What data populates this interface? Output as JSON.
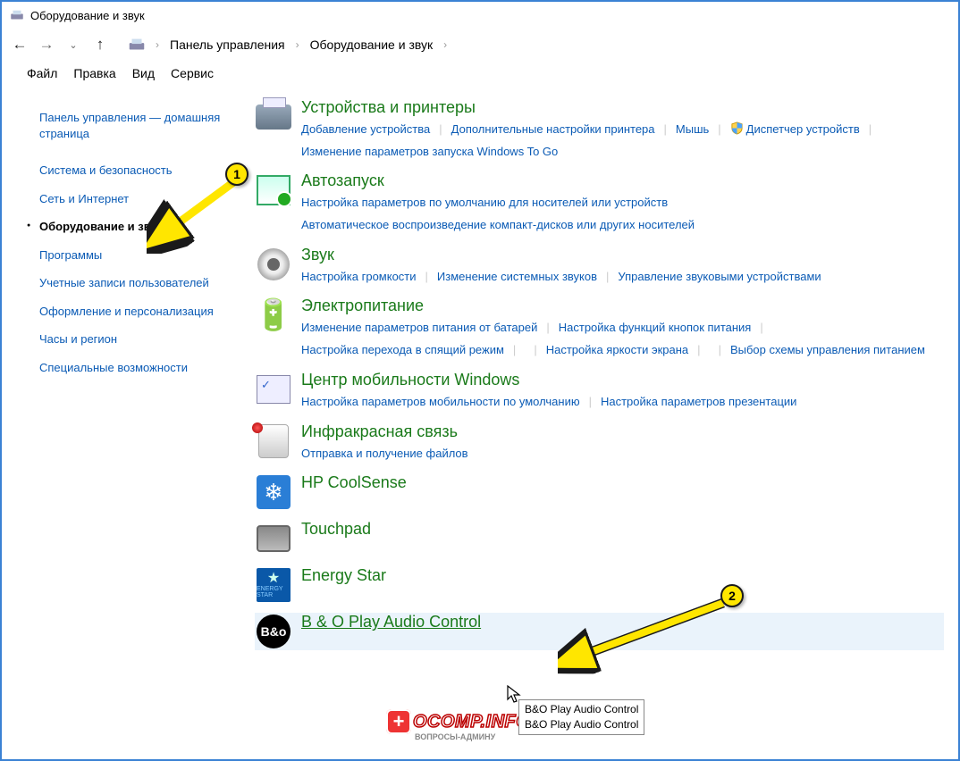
{
  "window": {
    "title": "Оборудование и звук"
  },
  "breadcrumb": {
    "root": "Панель управления",
    "current": "Оборудование и звук"
  },
  "menus": {
    "file": "Файл",
    "edit": "Правка",
    "view": "Вид",
    "service": "Сервис"
  },
  "sidebar": {
    "home": "Панель управления — домашняя страница",
    "items": [
      "Система и безопасность",
      "Сеть и Интернет",
      "Оборудование и звук",
      "Программы",
      "Учетные записи пользователей",
      "Оформление и персонализация",
      "Часы и регион",
      "Специальные возможности"
    ],
    "activeIndex": 2
  },
  "categories": [
    {
      "id": "devices",
      "title": "Устройства и принтеры",
      "sub": [
        "Добавление устройства",
        "Дополнительные настройки принтера",
        "Мышь",
        "Диспетчер устройств",
        "Изменение параметров запуска Windows To Go"
      ],
      "shieldIndex": 3
    },
    {
      "id": "autoplay",
      "title": "Автозапуск",
      "sub": [
        "Настройка параметров по умолчанию для носителей или устройств",
        "Автоматическое воспроизведение компакт-дисков или других носителей"
      ]
    },
    {
      "id": "sound",
      "title": "Звук",
      "sub": [
        "Настройка громкости",
        "Изменение системных звуков",
        "Управление звуковыми устройствами"
      ]
    },
    {
      "id": "power",
      "title": "Электропитание",
      "sub": [
        "Изменение параметров питания от батарей",
        "Настройка функций кнопок питания",
        "Настройка перехода в спящий режим",
        "Настройка яркости экрана",
        "Выбор схемы управления питанием"
      ]
    },
    {
      "id": "mobility",
      "title": "Центр мобильности Windows",
      "sub": [
        "Настройка параметров мобильности по умолчанию",
        "Настройка параметров презентации"
      ]
    },
    {
      "id": "infrared",
      "title": "Инфракрасная связь",
      "sub": [
        "Отправка и получение файлов"
      ]
    },
    {
      "id": "coolsense",
      "title": "HP CoolSense",
      "sub": []
    },
    {
      "id": "touchpad",
      "title": "Touchpad",
      "sub": []
    },
    {
      "id": "energystar",
      "title": "Energy Star",
      "sub": []
    },
    {
      "id": "bo",
      "title": "B & O Play Audio Control",
      "sub": [],
      "hovered": true
    }
  ],
  "tooltip": {
    "line1": "B&O Play Audio Control",
    "line2": "B&O Play Audio Control"
  },
  "badges": {
    "one": "1",
    "two": "2"
  },
  "watermark": {
    "text": "OCOMP.INFO",
    "sub": "ВОПРОСЫ-АДМИНУ"
  },
  "estar_label": "ENERGY STAR",
  "bo_label": "B&o"
}
